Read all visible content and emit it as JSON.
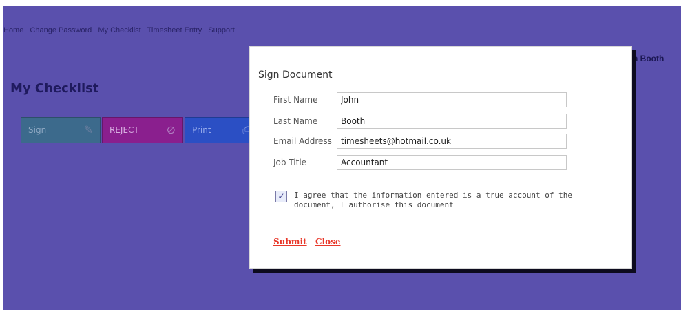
{
  "nav": {
    "items": [
      "Home",
      "Change Password",
      "My Checklist",
      "Timesheet Entry",
      "Support"
    ]
  },
  "user": {
    "name": "n Booth"
  },
  "page": {
    "heading": "My Checklist"
  },
  "actions": {
    "sign_label": "Sign",
    "sign_icon": "pen-icon",
    "reject_label": "REJECT",
    "reject_icon": "reject-icon",
    "print_label": "Print",
    "print_icon": "printer-icon"
  },
  "dialog": {
    "title": "Sign Document",
    "fields": [
      {
        "label": "First Name",
        "value": "John"
      },
      {
        "label": "Last Name",
        "value": "Booth"
      },
      {
        "label": "Email Address",
        "value": "timesheets@hotmail.co.uk"
      },
      {
        "label": "Job Title",
        "value": "Accountant"
      }
    ],
    "agree_checked": true,
    "agree_text": "I agree that the information entered is a true account of the document, I authorise this document",
    "submit_label": "Submit",
    "close_label": "Close"
  },
  "colors": {
    "background": "#5a50ad",
    "link_red": "#e8382a",
    "sign_button": "#3c6a8c",
    "reject_button": "#8a1f8e",
    "print_button": "#2b4fc4"
  }
}
